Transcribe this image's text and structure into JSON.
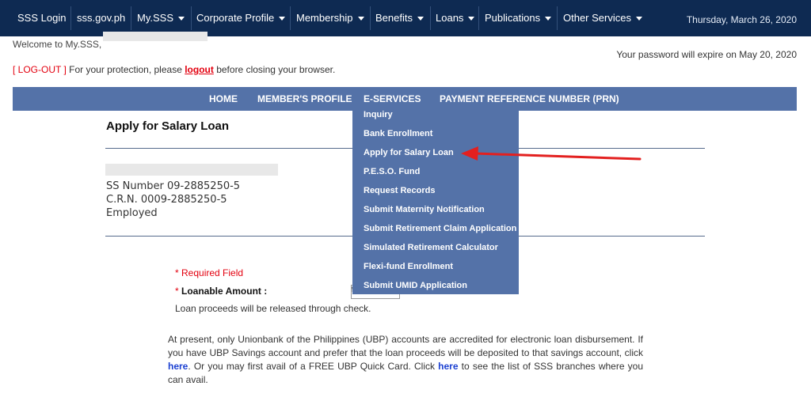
{
  "topnav": {
    "items": [
      {
        "label": "SSS Login"
      },
      {
        "label": "sss.gov.ph"
      },
      {
        "label": "My.SSS"
      },
      {
        "label": "Corporate Profile"
      },
      {
        "label": "Membership"
      },
      {
        "label": "Benefits"
      },
      {
        "label": "Loans"
      },
      {
        "label": "Publications"
      },
      {
        "label": "Other Services"
      }
    ],
    "date": "Thursday, March 26, 2020"
  },
  "welcome": "Welcome to My.SSS,",
  "password_notice": "Your password will expire on May 20, 2020",
  "logout_line": {
    "tag": "[ LOG-OUT ]",
    "text_before": " For your protection, please ",
    "link": "logout",
    "text_after": " before closing your browser."
  },
  "subnav": {
    "items": [
      {
        "label": "HOME"
      },
      {
        "label": "MEMBER'S PROFILE"
      },
      {
        "label": "E-SERVICES"
      },
      {
        "label": "PAYMENT REFERENCE NUMBER (PRN)"
      }
    ]
  },
  "dropdown": {
    "items": [
      {
        "label": "Inquiry"
      },
      {
        "label": "Bank Enrollment"
      },
      {
        "label": "Apply for Salary Loan"
      },
      {
        "label": "P.E.S.O. Fund"
      },
      {
        "label": "Request Records"
      },
      {
        "label": "Submit Maternity Notification"
      },
      {
        "label": "Submit Retirement Claim Application"
      },
      {
        "label": "Simulated Retirement Calculator"
      },
      {
        "label": "Flexi-fund Enrollment"
      },
      {
        "label": "Submit UMID Application"
      }
    ]
  },
  "page_title": "Apply for Salary Loan",
  "member": {
    "ss_number": "SS Number 09-2885250-5",
    "crn": "C.R.N. 0009-2885250-5",
    "status": "Employed"
  },
  "form": {
    "required_note": "* Required Field",
    "loanable_star": "* ",
    "loanable_label": "Loanable Amount :",
    "currency_symbol": "₱",
    "proceeds_note": "Loan proceeds will be released through check."
  },
  "info_paragraph": {
    "part1": "At present, only Unionbank of the Philippines (UBP) accounts are accredited for electronic loan disbursement. If you have UBP Savings account and prefer that the loan proceeds will be deposited to that savings account, click ",
    "link1": "here",
    "part2": ". Or you may first avail of a FREE UBP Quick Card. Click ",
    "link2": "here",
    "part3": " to see the list of SSS branches where you can avail."
  },
  "colors": {
    "topnav_bg": "#0e2a52",
    "subnav_bg": "#5472a8",
    "accent_red": "#e3000f",
    "link_blue": "#1a3fd1"
  }
}
